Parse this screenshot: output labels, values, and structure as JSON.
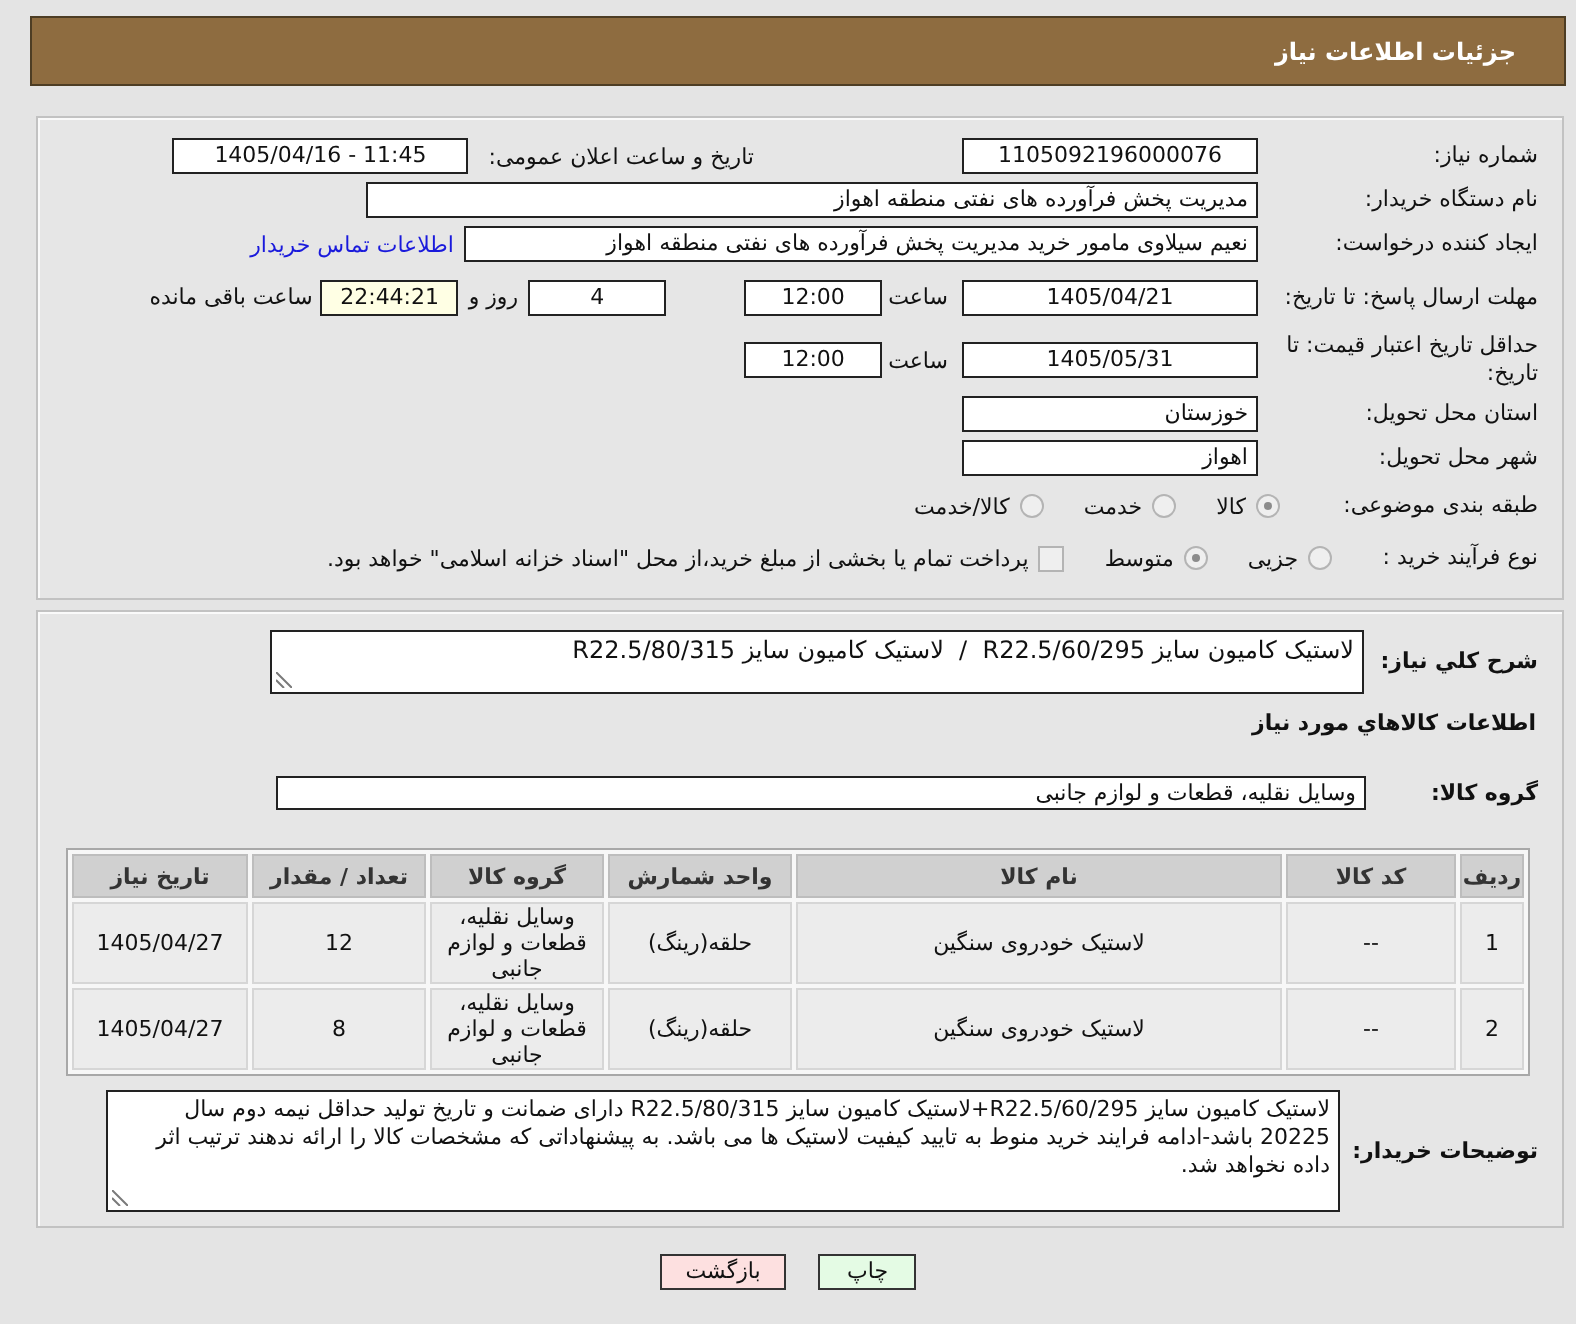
{
  "header": {
    "title": "جزئیات اطلاعات نیاز"
  },
  "need": {
    "number_label": "شماره نیاز:",
    "number": "1105092196000076",
    "announce_label": "تاریخ و ساعت اعلان عمومی:",
    "announce": "1405/04/16 - 11:45",
    "buyer_label": "نام دستگاه خریدار:",
    "buyer": "مدیریت پخش فرآورده های نفتی منطقه اهواز",
    "creator_label": "ایجاد کننده درخواست:",
    "creator": "نعیم سیلاوی مامور خرید مدیریت پخش فرآورده های نفتی منطقه اهواز",
    "contact_link": "اطلاعات تماس خریدار",
    "deadline": {
      "label": "مهلت ارسال پاسخ: تا تاریخ:",
      "date": "1405/04/21",
      "time_label": "ساعت",
      "time": "12:00",
      "days": "4",
      "days_label": "روز و",
      "remaining": "22:44:21",
      "remaining_label": "ساعت باقی مانده"
    },
    "validity": {
      "label": "حداقل تاریخ اعتبار قیمت: تا تاریخ:",
      "date": "1405/05/31",
      "time_label": "ساعت",
      "time": "12:00"
    },
    "province_label": "استان محل تحویل:",
    "province": "خوزستان",
    "city_label": "شهر محل تحویل:",
    "city": "اهواز",
    "category": {
      "label": "طبقه بندی موضوعی:",
      "options": [
        {
          "label": "کالا",
          "selected": true,
          "disabled": true
        },
        {
          "label": "خدمت",
          "selected": false,
          "disabled": true
        },
        {
          "label": "کالا/خدمت",
          "selected": false,
          "disabled": true
        }
      ]
    },
    "process": {
      "label": "نوع فرآیند خرید :",
      "options": [
        {
          "label": "جزیی",
          "selected": false,
          "disabled": true
        },
        {
          "label": "متوسط",
          "selected": true,
          "disabled": true
        }
      ],
      "treasury": {
        "label": "پرداخت تمام یا بخشی از مبلغ خرید،از محل \"اسناد خزانه اسلامی\" خواهد بود.",
        "checked": false,
        "disabled": true
      }
    }
  },
  "goods": {
    "summary_label": "شرح کلي نياز:",
    "summary": "لاستیک کامیون سایز R22.5/60/295  /  لاستیک کامیون سایز R22.5/80/315",
    "section_title": "اطلاعات کالاهاي مورد نياز",
    "group_label": "گروه کالا:",
    "group": "وسایل نقلیه، قطعات و لوازم جانبی",
    "table": {
      "columns": [
        "ردیف",
        "کد کالا",
        "نام کالا",
        "واحد شمارش",
        "گروه کالا",
        "تعداد / مقدار",
        "تاریخ نیاز"
      ],
      "rows": [
        [
          "1",
          "--",
          "لاستیک خودروی سنگین",
          "حلقه(رینگ)",
          "وسایل نقلیه، قطعات و لوازم جانبی",
          "12",
          "1405/04/27"
        ],
        [
          "2",
          "--",
          "لاستیک خودروی سنگین",
          "حلقه(رینگ)",
          "وسایل نقلیه، قطعات و لوازم جانبی",
          "8",
          "1405/04/27"
        ]
      ]
    },
    "notes_label": "توضیحات خریدار:",
    "notes": "لاستیک کامیون سایز R22.5/60/295+لاستیک کامیون سایز R22.5/80/315 دارای ضمانت و تاریخ تولید حداقل نیمه دوم سال 20225 باشد-ادامه فرایند خرید منوط به تایید کیفیت لاستیک ها می باشد. به پیشنهاداتی که مشخصات کالا را ارائه ندهند ترتیب اثر داده نخواهد شد."
  },
  "buttons": [
    {
      "label": "چاپ",
      "kind": "print"
    },
    {
      "label": "بازگشت",
      "kind": "back"
    }
  ]
}
